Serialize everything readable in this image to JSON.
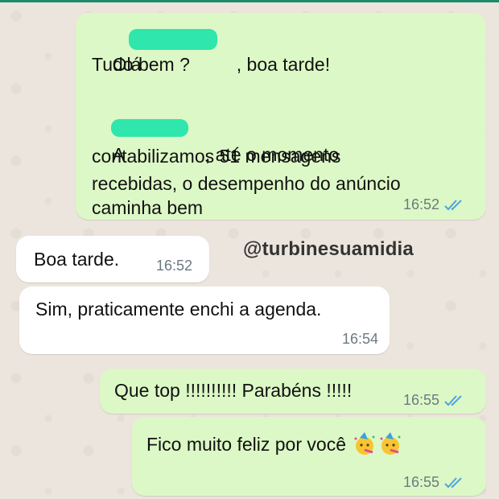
{
  "messages": [
    {
      "direction": "outgoing",
      "line1_a": "Olá ",
      "line1_b": ", boa tarde!",
      "line2": "Tudo bem ?",
      "line3_a": "A",
      "line3_b": ", até o momento",
      "line4": "contabilizamos 51 mensagens",
      "line5": "recebidas, o desempenho do anúncio",
      "line6": "caminha bem",
      "time": "16:52",
      "status": "read"
    },
    {
      "direction": "incoming",
      "text": "Boa tarde.",
      "time": "16:52"
    },
    {
      "direction": "incoming",
      "text": "Sim, praticamente enchi a agenda.",
      "time": "16:54"
    },
    {
      "direction": "outgoing",
      "text": "Que top !!!!!!!!!! Parabéns !!!!!",
      "time": "16:55",
      "status": "read"
    },
    {
      "direction": "outgoing",
      "text": "Fico muito feliz por você",
      "emoji": [
        "party-face-icon",
        "party-face-icon"
      ],
      "time": "16:55",
      "status": "read"
    }
  ],
  "watermark": "@turbinesuamidia",
  "colors": {
    "outgoing_bubble": "#dcf8c6",
    "incoming_bubble": "#ffffff",
    "read_ticks": "#4fa3e0",
    "redaction": "#2fe6ad"
  }
}
